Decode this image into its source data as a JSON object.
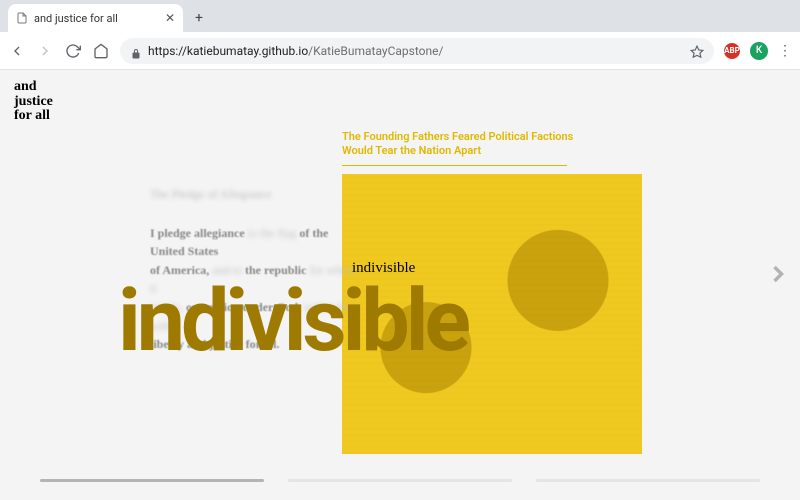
{
  "browser": {
    "tab_title": "and justice for all",
    "url_host": "https://katiebumatay.github.io",
    "url_path": "/KatieBumatayCapstone/",
    "ext_label": "ABP",
    "avatar_initial": "K"
  },
  "page": {
    "logo_line1": "and",
    "logo_line2": "justice",
    "logo_line3": "for all",
    "article_title": "The Founding Fathers Feared Political Factions Would Tear the Nation Apart",
    "pledge_heading": "The Pledge of Allegiance",
    "pledge_l1a": "I pledge allegiance",
    "pledge_l1b": "to the flag",
    "pledge_l1c": "of the United States",
    "pledge_l2a": "of America,",
    "pledge_l2b": "and to",
    "pledge_l2c": "the republic",
    "pledge_l2d": "for which it",
    "pledge_l3a": "stands,",
    "pledge_l3b": "one nation under God,",
    "pledge_l3c": "indivisible, with",
    "pledge_l4": "liberty and justice for all.",
    "small_word": "indivisible",
    "big_word": "indivisible",
    "progress_segments": 3,
    "active_segment": 0
  },
  "colors": {
    "accent": "#e0b800",
    "big_word": "#9e7b00"
  }
}
